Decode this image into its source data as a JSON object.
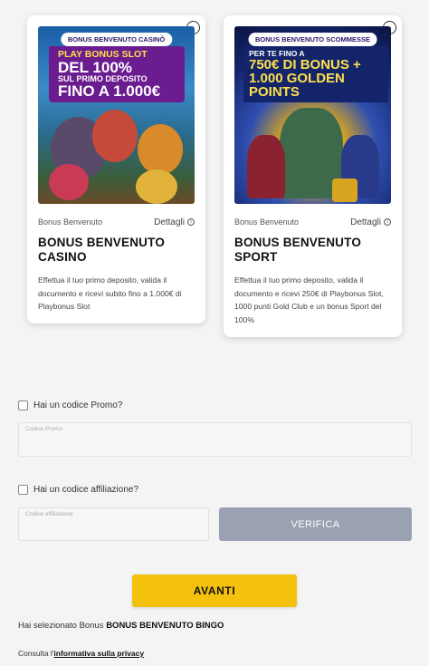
{
  "cards": [
    {
      "banner_tag": "BONUS BENVENUTO CASINÒ",
      "banner_line1": "PLAY BONUS SLOT",
      "banner_line2": "DEL 100%",
      "banner_line3": "SUL PRIMO DEPOSITO",
      "banner_line4": "FINO A 1.000€",
      "kind": "Bonus Benvenuto",
      "details_label": "Dettagli",
      "title": "BONUS BENVENUTO CASINO",
      "description": "Effettua il tuo primo deposito, valida il documento e ricevi subito fino a 1.000€ di Playbonus Slot"
    },
    {
      "banner_tag": "BONUS BENVENUTO SCOMMESSE",
      "banner_line1": "PER TE FINO A",
      "banner_line2": "750€ DI BONUS +",
      "banner_line3": "1.000 GOLDEN POINTS",
      "kind": "Bonus Benvenuto",
      "details_label": "Dettagli",
      "title": "BONUS BENVENUTO SPORT",
      "description": "Effettua il tuo primo deposito, valida il documento e ricevi 250€ di Playbonus Slot, 1000 punti Gold Club e un bonus Sport del 100%"
    }
  ],
  "promo": {
    "checkbox_label": "Hai un codice Promo?",
    "field_placeholder": "Codice Promo"
  },
  "affiliation": {
    "checkbox_label": "Hai un codice affiliazione?",
    "field_placeholder": "Codice affiliazione",
    "verify_label": "VERIFICA"
  },
  "next_label": "AVANTI",
  "selection": {
    "prefix": "Hai selezionato Bonus",
    "value": "BONUS BENVENUTO BINGO"
  },
  "privacy": {
    "prefix": "Consulta l'",
    "link": "informativa sulla privacy"
  },
  "colors": {
    "accent": "#f4c20d",
    "verify_disabled": "#9aa1b3",
    "casino_banner": "#6b1c8f",
    "sport_banner": "#13246b"
  }
}
